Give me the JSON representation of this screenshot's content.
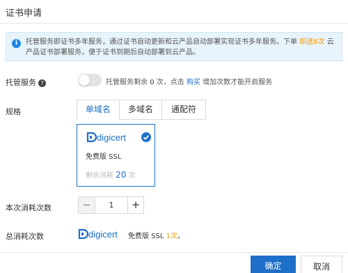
{
  "dialog": {
    "title": "证书申请"
  },
  "notice": {
    "icon": "info-icon",
    "text_before": "托管服务即证书多年服务，通过证书自动更新和云产品自动部署实现证书多年服务。下单",
    "link": "即送8次",
    "text_after": "云产品证书部署服务，便于证书到期后自动部署到云产品。"
  },
  "hosting": {
    "label": "托管服务",
    "help_icon": "question-icon",
    "toggle_on": false,
    "text_prefix": "托管服务剩余",
    "count": "0",
    "text_mid": "次，点击",
    "buy_link": "购买",
    "text_suffix": "增加次数才能开启服务"
  },
  "spec": {
    "label": "规格",
    "tabs": [
      "单域名",
      "多域名",
      "通配符"
    ],
    "active_tab": 0
  },
  "card": {
    "brand": "digicert",
    "product": "免费版 SSL",
    "remaining_label": "剩余消耗",
    "remaining_count": "20",
    "remaining_unit": "次",
    "selected": true
  },
  "consume": {
    "label": "本次消耗次数",
    "minus": "−",
    "value": "1",
    "plus": "+"
  },
  "total": {
    "label": "总消耗次数",
    "brand": "digicert",
    "product": "免费版 SSL",
    "times": "1次",
    "period": "。"
  },
  "footer": {
    "confirm": "确定",
    "cancel": "取消"
  },
  "colors": {
    "primary": "#1e6fc8",
    "accent": "#f39800",
    "notice_bg": "#e8f4fb"
  }
}
